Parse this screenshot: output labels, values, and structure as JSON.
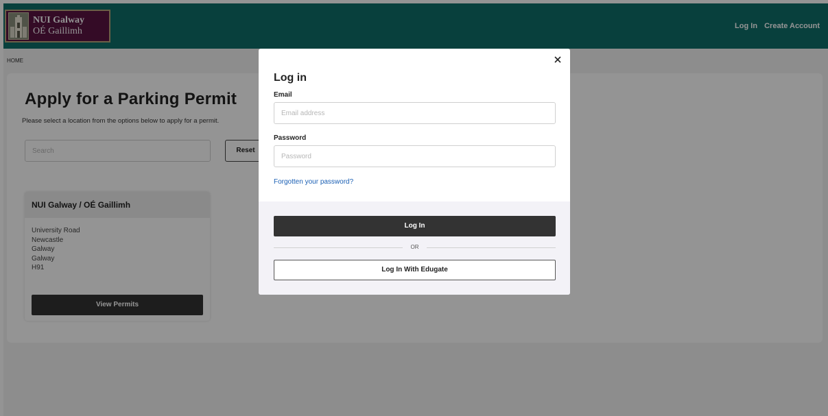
{
  "header": {
    "logo_line1": "NUI Galway",
    "logo_line2": "OÉ Gaillimh",
    "login_link": "Log In",
    "create_account_link": "Create Account"
  },
  "breadcrumb": {
    "home": "HOME"
  },
  "main": {
    "title": "Apply for a Parking Permit",
    "description": "Please select a location from the options below to apply for a permit.",
    "search_placeholder": "Search",
    "reset_label": "Reset",
    "location_card": {
      "title": "NUI Galway / OÉ Gaillimh",
      "address": [
        "University Road",
        "Newcastle",
        "Galway",
        "Galway",
        "H91"
      ],
      "button_label": "View Permits"
    }
  },
  "modal": {
    "title": "Log in",
    "email_label": "Email",
    "email_placeholder": "Email address",
    "password_label": "Password",
    "password_placeholder": "Password",
    "forgot_link": "Forgotten your password?",
    "login_button": "Log In",
    "or_text": "OR",
    "edugate_button": "Log In With Edugate",
    "close_icon": "close-icon"
  },
  "colors": {
    "header_bg": "#0e6e6a",
    "logo_bg": "#5a1343",
    "button_dark": "#333333",
    "link_blue": "#1a5fb4"
  }
}
